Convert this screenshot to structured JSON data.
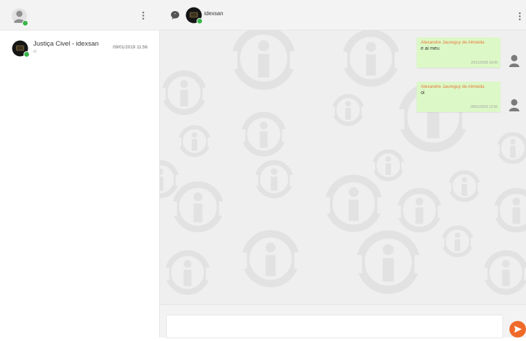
{
  "sidebar": {
    "menu_icon": "kebab-vertical-icon",
    "conversations": [
      {
        "name": "Justiça Civel - idexsan",
        "last_message": "oi",
        "time": "09/01/2019 11:56"
      }
    ]
  },
  "chat": {
    "header": {
      "icon": "chat-bubble-icon",
      "title": "idexsan",
      "menu_icon": "kebab-vertical-icon"
    },
    "messages": [
      {
        "author": "Alexandre Jaureguy de Almeida",
        "text": "e ai meu",
        "time": "22/11/2018 19:00"
      },
      {
        "author": "Alexandre Jaureguy de Almeida",
        "text": "oi",
        "time": "09/01/2019 12:56"
      }
    ],
    "composer": {
      "placeholder": "",
      "send_icon": "send-arrow-icon"
    }
  },
  "colors": {
    "header_bg": "#f3f3f3",
    "chat_bg": "#efefef",
    "bubble_bg": "#dcf8c6",
    "author_color": "#e9773b",
    "online_status": "#39b54a",
    "send_button": "#ef6a2a"
  }
}
